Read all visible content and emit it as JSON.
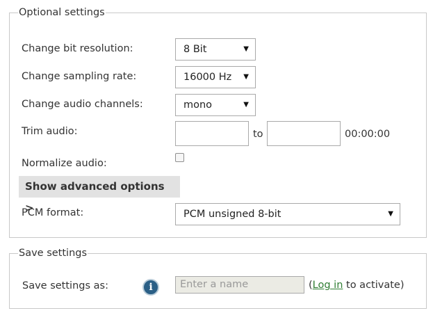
{
  "optional": {
    "legend": "Optional settings",
    "bit_resolution": {
      "label": "Change bit resolution:",
      "value": "8 Bit"
    },
    "sampling_rate": {
      "label": "Change sampling rate:",
      "value": "16000 Hz"
    },
    "channels": {
      "label": "Change audio channels:",
      "value": "mono"
    },
    "trim": {
      "label": "Trim audio:",
      "start_value": "",
      "to_label": "to",
      "end_value": "",
      "duration": "00:00:00"
    },
    "normalize": {
      "label": "Normalize audio:",
      "checked": false
    },
    "advanced_button": "Show advanced options >",
    "pcm": {
      "label": "PCM format:",
      "value": "PCM unsigned 8-bit"
    }
  },
  "save": {
    "legend": "Save settings",
    "label": "Save settings as:",
    "input_placeholder": "Enter a name",
    "login_prefix": "(",
    "login_link": "Log in",
    "login_suffix": " to activate)"
  },
  "icons": {
    "dropdown": "triangle-down-icon",
    "info": "info-icon"
  },
  "colors": {
    "link": "#2e7d32",
    "info_icon": "#2a5f86",
    "button_bg": "#e2e2e2"
  }
}
